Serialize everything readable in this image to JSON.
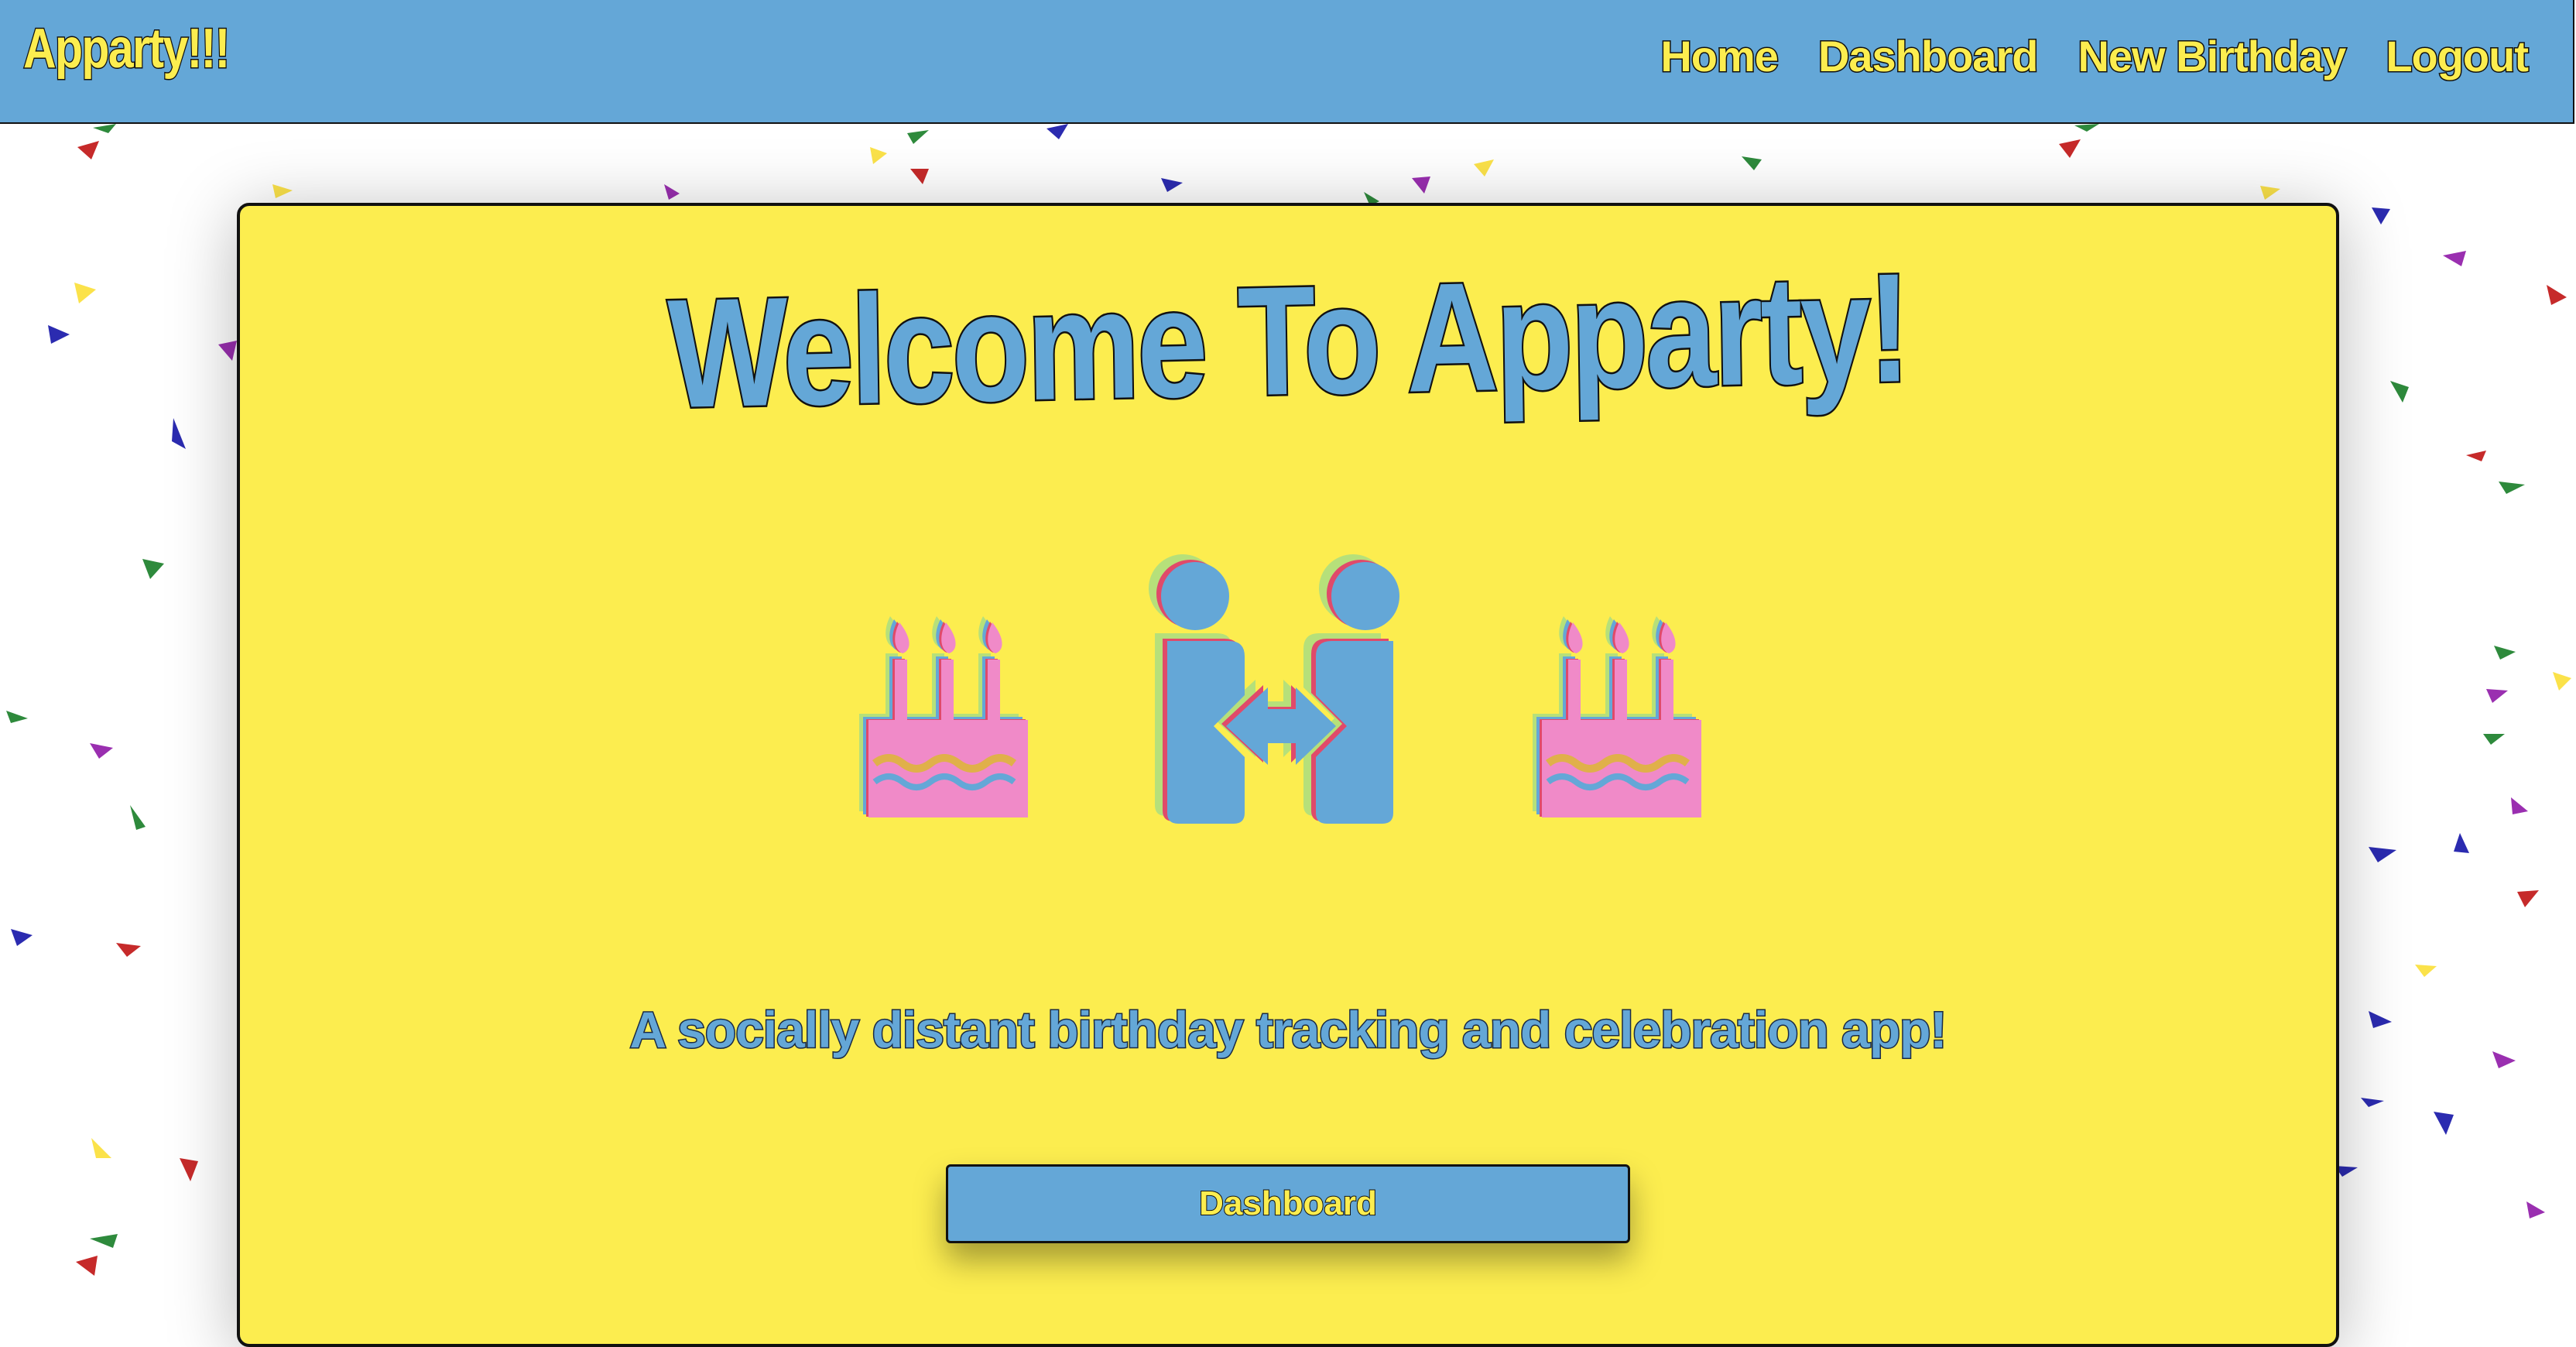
{
  "nav": {
    "brand": "Apparty!!!",
    "links": [
      "Home",
      "Dashboard",
      "New Birthday",
      "Logout"
    ]
  },
  "hero": {
    "title": "Welcome To Apparty!",
    "subtitle": "A socially distant birthday tracking and celebration app!",
    "button_label": "Dashboard",
    "icons": [
      "birthday-cake-icon",
      "people-arrows-icon",
      "birthday-cake-icon"
    ]
  },
  "colors": {
    "nav_bg": "#64a7d7",
    "brand_text": "#fced4f",
    "card_bg": "#fced4f",
    "accent_blue": "#64a7d7",
    "cake_pink": "#f08ac8",
    "confetti": [
      "#2b2bb0",
      "#c62a2a",
      "#2e8a3c",
      "#9a2fb0",
      "#fbe24a"
    ]
  }
}
